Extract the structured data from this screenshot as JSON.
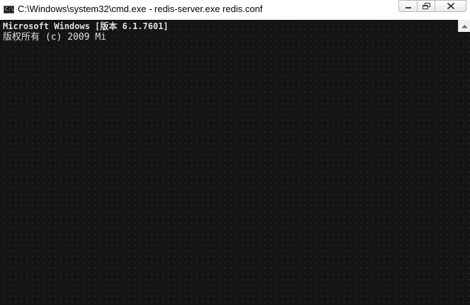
{
  "window": {
    "title": "C:\\Windows\\system32\\cmd.exe - redis-server.exe  redis.conf",
    "icon": "cmd-prompt-icon",
    "icon_label": "C:\\",
    "buttons": {
      "minimize": "minimize-icon",
      "maximize": "maximize-icon",
      "close": "close-icon"
    }
  },
  "console": {
    "lines": [
      "Microsoft Windows [版本 6.1.7601]",
      "版权所有 (c) 2009 Mi"
    ],
    "colors": {
      "background": "#141414",
      "text": "#e0e0e0"
    }
  },
  "scrollbar": {
    "up_arrow": "scroll-up-arrow-icon"
  }
}
